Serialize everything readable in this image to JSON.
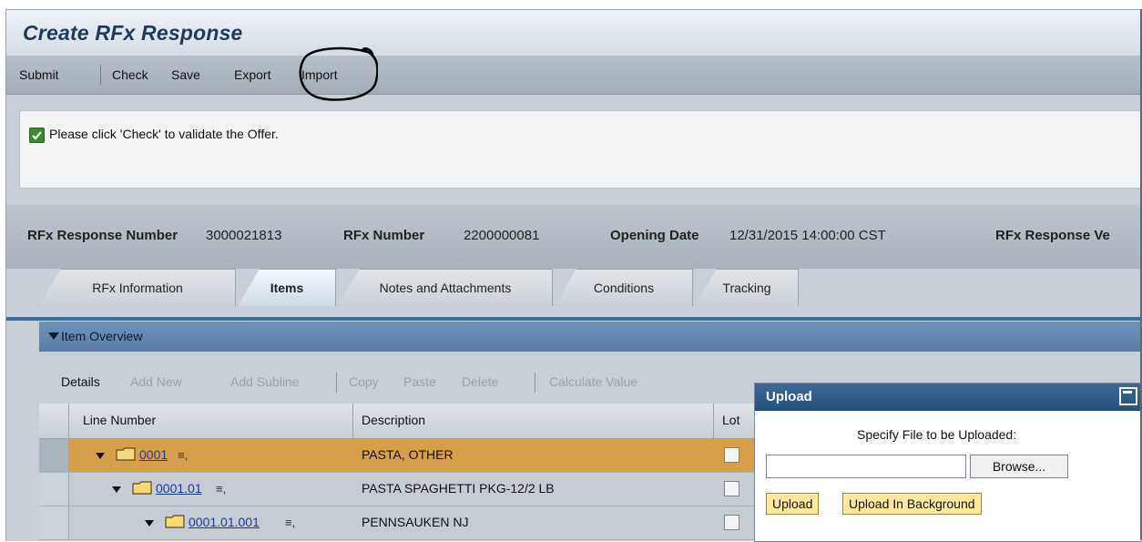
{
  "title": "Create RFx Response",
  "toolbar": {
    "submit": "Submit",
    "check": "Check",
    "save": "Save",
    "export": "Export",
    "import": "Import"
  },
  "message": "Please click 'Check' to validate the Offer.",
  "info": {
    "response_number_label": "RFx Response Number",
    "response_number": "3000021813",
    "rfx_number_label": "RFx Number",
    "rfx_number": "2200000081",
    "opening_date_label": "Opening Date",
    "opening_date": "12/31/2015 14:00:00 CST",
    "response_version_label": "RFx Response Ve"
  },
  "tabs": [
    "RFx Information",
    "Items",
    "Notes and Attachments",
    "Conditions",
    "Tracking"
  ],
  "active_tab": "Items",
  "panel_title": "Item Overview",
  "item_toolbar": {
    "details": "Details",
    "add_new": "Add New",
    "add_subline": "Add Subline",
    "copy": "Copy",
    "paste": "Paste",
    "delete": "Delete",
    "calculate_value": "Calculate Value"
  },
  "grid": {
    "headers": {
      "line_number": "Line Number",
      "description": "Description",
      "lot": "Lot"
    },
    "rows": [
      {
        "line": "0001",
        "description": "PASTA, OTHER",
        "lot": false,
        "highlight": true
      },
      {
        "line": "0001.01",
        "description": "PASTA SPAGHETTI PKG-12/2 LB",
        "lot": false,
        "highlight": false
      },
      {
        "line": "0001.01.001",
        "description": "PENNSAUKEN NJ",
        "lot": false,
        "highlight": false
      }
    ]
  },
  "upload_dialog": {
    "title": "Upload",
    "prompt": "Specify File to be Uploaded:",
    "file_value": "",
    "browse": "Browse...",
    "upload": "Upload",
    "upload_background": "Upload In Background"
  },
  "colors": {
    "title": "#1f3a5a",
    "highlight_row": "#d79f4a",
    "row_bg": "#c5ccd3",
    "panel": "#5f86ae",
    "dialog_header": "#24507e",
    "upload_button": "#ffe79c"
  }
}
